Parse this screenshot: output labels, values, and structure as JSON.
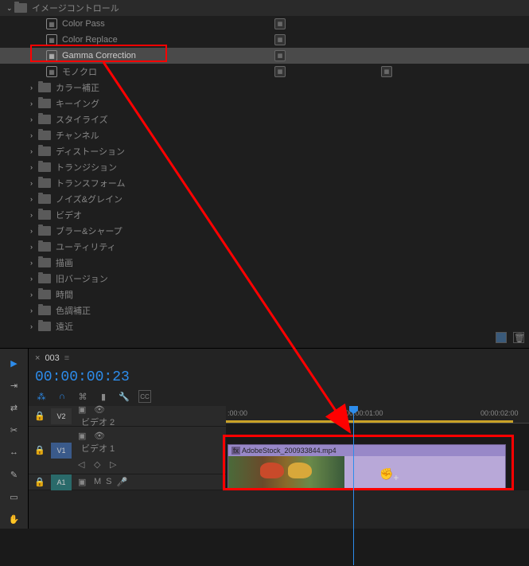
{
  "effects": {
    "expanded_folder": "イメージコントロール",
    "items": [
      {
        "label": "Color Pass",
        "type": "preset"
      },
      {
        "label": "Color Replace",
        "type": "preset"
      },
      {
        "label": "Gamma Correction",
        "type": "preset",
        "selected": true
      },
      {
        "label": "モノクロ",
        "type": "preset",
        "extra_badge": true
      }
    ],
    "folders": [
      "カラー補正",
      "キーイング",
      "スタイライズ",
      "チャンネル",
      "ディストーション",
      "トランジション",
      "トランスフォーム",
      "ノイズ&グレイン",
      "ビデオ",
      "ブラー&シャープ",
      "ユーティリティ",
      "描画",
      "旧バージョン",
      "時間",
      "色調補正",
      "遠近"
    ]
  },
  "sequence": {
    "name": "003",
    "timecode": "00:00:00:23",
    "ruler": {
      "t0": ":00:00",
      "t1": "00:00:01:00",
      "t2": "00:00:02:00"
    },
    "tracks": {
      "v2": {
        "id": "V2",
        "name": "ビデオ 2"
      },
      "v1": {
        "id": "V1",
        "name": "ビデオ 1"
      },
      "a1": {
        "id": "A1",
        "toggles": {
          "m": "M",
          "s": "S"
        }
      }
    },
    "clip": {
      "label": "AdobeStock_200933844.mp4"
    }
  }
}
